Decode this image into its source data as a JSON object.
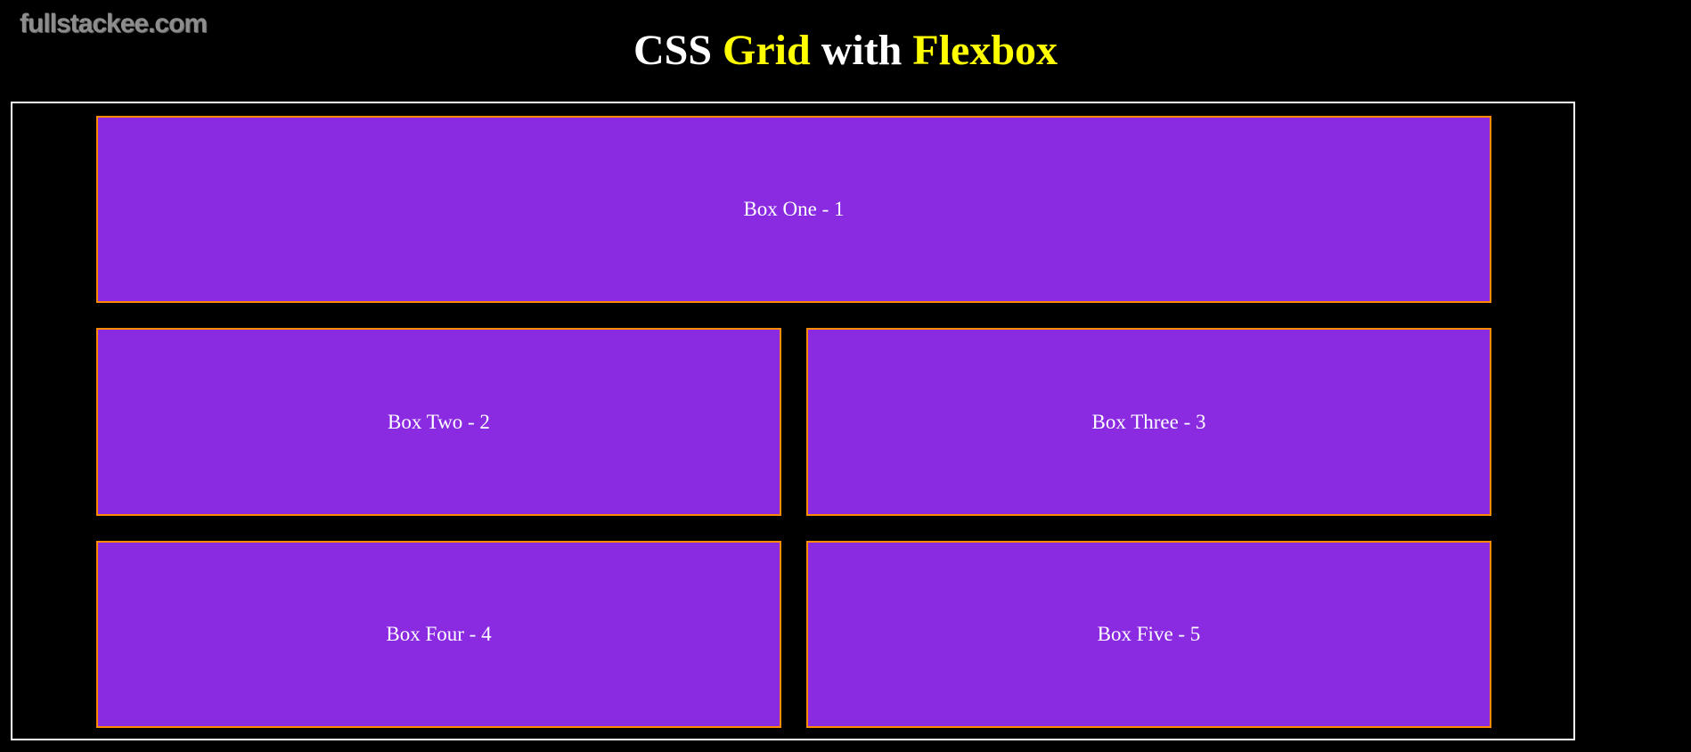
{
  "watermark": "fullstackee.com",
  "title": {
    "part1": "CSS ",
    "part2": "Grid",
    "part3": " with ",
    "part4": "Flexbox"
  },
  "boxes": [
    {
      "label": "Box One - 1"
    },
    {
      "label": "Box Two - 2"
    },
    {
      "label": "Box Three - 3"
    },
    {
      "label": "Box Four - 4"
    },
    {
      "label": "Box Five - 5"
    }
  ],
  "colors": {
    "background": "#000000",
    "title_text": "#ffffff",
    "title_highlight": "#ffff00",
    "box_fill": "#8a2be2",
    "box_border": "#ff8c00",
    "container_border": "#ffffff",
    "watermark": "#8d8d8d"
  }
}
